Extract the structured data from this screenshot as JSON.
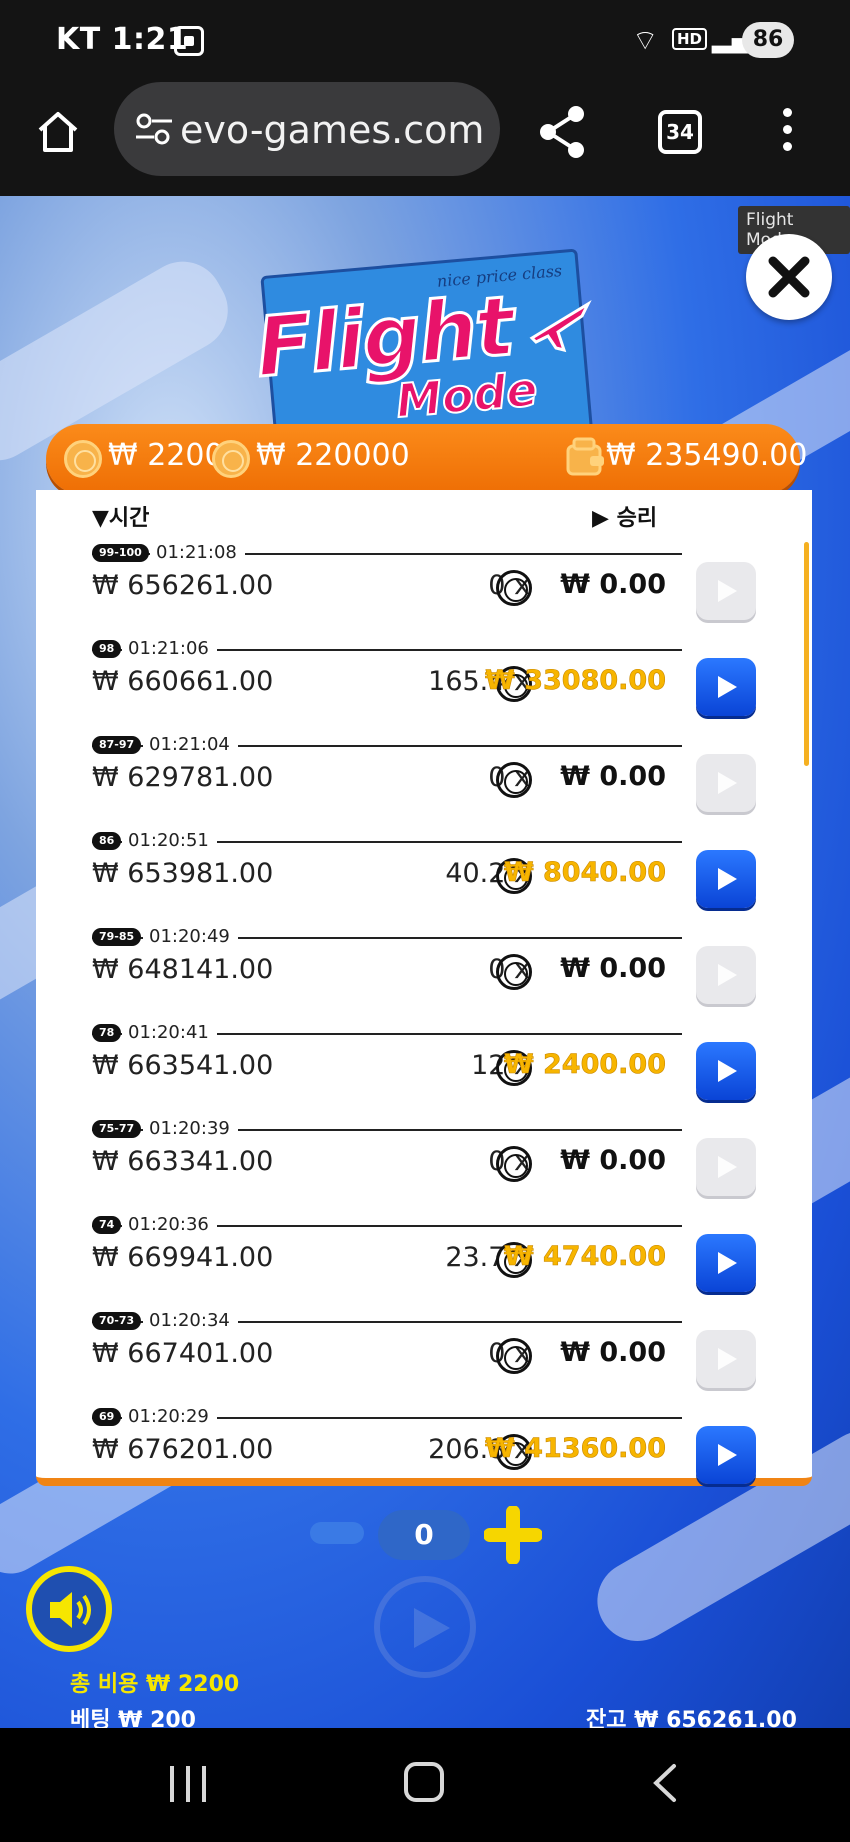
{
  "status_bar": {
    "carrier": "KT",
    "time": "1:21",
    "network": "HD",
    "battery": "86"
  },
  "browser": {
    "url": "evo-games.com",
    "tab_count": "34"
  },
  "game": {
    "mode_tag": "Flight Mode",
    "logo_title": "Flight",
    "logo_subtitle": "Mode",
    "ticket_text": "nice price class",
    "header": {
      "coin_value": "₩ 2200",
      "total_value": "₩ 220000",
      "wallet_value": "₩ 235490.00"
    },
    "history": {
      "col_time": "▼시간",
      "col_win": "▶ 승리",
      "rows": [
        {
          "badge": "99-100",
          "time": "01:21:08",
          "balance": "₩ 656261.00",
          "multiplier": "0 x",
          "win": "₩ 0.00",
          "won": false
        },
        {
          "badge": "98",
          "time": "01:21:06",
          "balance": "₩ 660661.00",
          "multiplier": "165.4 x",
          "win": "₩ 33080.00",
          "won": true
        },
        {
          "badge": "87-97",
          "time": "01:21:04",
          "balance": "₩ 629781.00",
          "multiplier": "0 x",
          "win": "₩ 0.00",
          "won": false
        },
        {
          "badge": "86",
          "time": "01:20:51",
          "balance": "₩ 653981.00",
          "multiplier": "40.2 x",
          "win": "₩ 8040.00",
          "won": true
        },
        {
          "badge": "79-85",
          "time": "01:20:49",
          "balance": "₩ 648141.00",
          "multiplier": "0 x",
          "win": "₩ 0.00",
          "won": false
        },
        {
          "badge": "78",
          "time": "01:20:41",
          "balance": "₩ 663541.00",
          "multiplier": "12 x",
          "win": "₩ 2400.00",
          "won": true
        },
        {
          "badge": "75-77",
          "time": "01:20:39",
          "balance": "₩ 663341.00",
          "multiplier": "0 x",
          "win": "₩ 0.00",
          "won": false
        },
        {
          "badge": "74",
          "time": "01:20:36",
          "balance": "₩ 669941.00",
          "multiplier": "23.7 x",
          "win": "₩ 4740.00",
          "won": true
        },
        {
          "badge": "70-73",
          "time": "01:20:34",
          "balance": "₩ 667401.00",
          "multiplier": "0 x",
          "win": "₩ 0.00",
          "won": false
        },
        {
          "badge": "69",
          "time": "01:20:29",
          "balance": "₩ 676201.00",
          "multiplier": "206.8 x",
          "win": "₩ 41360.00",
          "won": true
        }
      ]
    },
    "stepper_value": "0",
    "footer": {
      "total_cost": "총 비용  ₩ 2200",
      "bet": "베팅  ₩ 200",
      "balance": "잔고  ₩ 656261.00"
    }
  },
  "colors": {
    "accent_orange": "#f08414",
    "win_gold": "#f7b500",
    "play_blue": "#0a44d6"
  }
}
